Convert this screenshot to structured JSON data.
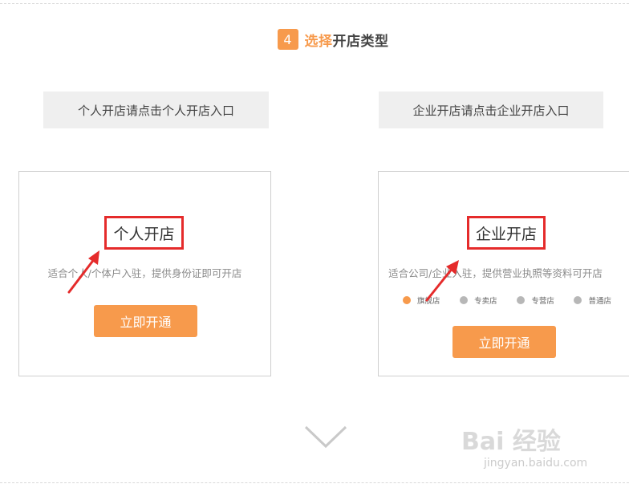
{
  "step": {
    "number": "4",
    "title_accent": "选择",
    "title_rest": "开店类型"
  },
  "entries": {
    "personal": "个人开店请点击个人开店入口",
    "company": "企业开店请点击企业开店入口"
  },
  "cards": {
    "personal": {
      "title": "个人开店",
      "desc": "适合个人/个体户入驻，提供身份证即可开店",
      "button": "立即开通"
    },
    "company": {
      "title": "企业开店",
      "desc": "适合公司/企业入驻，提供营业执照等资料可开店",
      "store_types": [
        {
          "label": "旗舰店",
          "active": true
        },
        {
          "label": "专卖店",
          "active": false
        },
        {
          "label": "专营店",
          "active": false
        },
        {
          "label": "普通店",
          "active": false
        }
      ],
      "button": "立即开通"
    }
  },
  "icons": {
    "next": "chevron-down-icon",
    "annotation": "red-arrow-icon"
  },
  "colors": {
    "accent": "#f79a4c",
    "highlight": "#e52b2b",
    "label_bg": "#efefef"
  },
  "watermark": {
    "logo": "Bai 经验",
    "url": "jingyan.baidu.com"
  }
}
